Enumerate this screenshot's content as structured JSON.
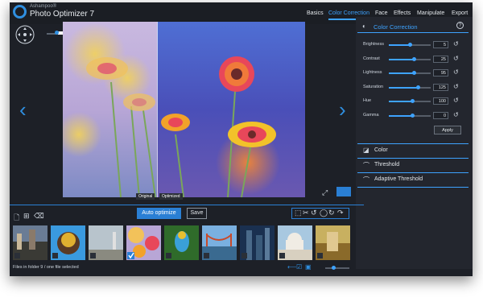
{
  "app": {
    "brand_small": "Ashampoo®",
    "brand_title": "Photo Optimizer 7"
  },
  "nav": {
    "items": [
      {
        "label": "Basics"
      },
      {
        "label": "Color Correction"
      },
      {
        "label": "Face"
      },
      {
        "label": "Effects"
      },
      {
        "label": "Manipulate"
      },
      {
        "label": "Export"
      }
    ],
    "active": "Color Correction"
  },
  "preview": {
    "original_label": "Original",
    "optimized_label": "Optimized"
  },
  "panel": {
    "title": "Color Correction",
    "help": "?",
    "sliders": [
      {
        "label": "Brightness",
        "value": "5",
        "level": 0.5
      },
      {
        "label": "Contrast",
        "value": "25",
        "level": 0.6
      },
      {
        "label": "Lightness",
        "value": "95",
        "level": 0.6
      },
      {
        "label": "Saturation",
        "value": "125",
        "level": 0.7
      },
      {
        "label": "Hue",
        "value": "100",
        "level": 0.55
      },
      {
        "label": "Gamma",
        "value": "0",
        "level": 0.55
      }
    ],
    "apply_label": "Apply",
    "sections": [
      {
        "label": "Color"
      },
      {
        "label": "Threshold"
      },
      {
        "label": "Adaptive Threshold"
      }
    ]
  },
  "toolbar": {
    "auto_optimize_label": "Auto optimize",
    "save_label": "Save"
  },
  "status": {
    "text": "Files in folder 9 / one file selected"
  },
  "colors": {
    "accent": "#3ea3ff",
    "background": "#1d2027",
    "panel": "#23262e"
  }
}
